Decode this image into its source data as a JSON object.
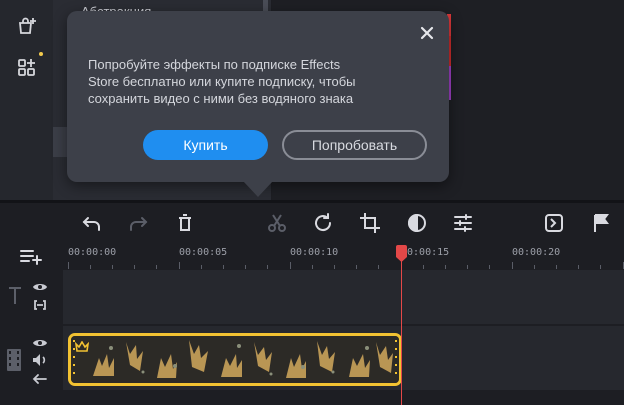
{
  "library": {
    "visible_item": "Абстракция"
  },
  "popup": {
    "lines": [
      "Попробуйте эффекты по подписке Effects",
      "Store бесплатно или купите подписку, чтобы",
      "сохранить видео с ними без водяного знака"
    ],
    "buy_label": "Купить",
    "try_label": "Попробовать"
  },
  "ruler": {
    "labels": [
      "00:00:00",
      "00:00:05",
      "00:00:10",
      "00:00:15",
      "00:00:20"
    ]
  },
  "colors": {
    "accent_blue": "#1f8ef0",
    "clip_border": "#f2c232",
    "playhead": "#e44848",
    "premium_dot": "#f2c94c"
  },
  "icons": {
    "left_strip": [
      "store-bag-icon",
      "widgets-add-icon"
    ],
    "toolbar": [
      "undo-icon",
      "redo-icon",
      "delete-icon",
      "cut-icon",
      "rotate-icon",
      "crop-icon",
      "color-adjust-icon",
      "properties-icon",
      "export-clip-icon",
      "marker-flag-icon"
    ],
    "tracks": [
      "text-track-icon",
      "eye-icon",
      "link-icon",
      "video-track-icon",
      "eye-icon",
      "volume-icon",
      "arrow-left-icon"
    ]
  }
}
